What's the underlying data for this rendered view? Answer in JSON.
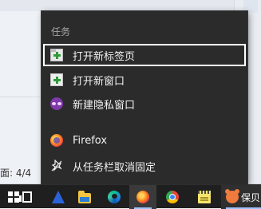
{
  "background": {
    "page_status": "面: 4/4",
    "accent_color": "#4a7bd0"
  },
  "jump_list": {
    "section_header": "任务",
    "tasks": [
      {
        "label": "打开新标签页",
        "icon": "new-tab-icon",
        "active": true
      },
      {
        "label": "打开新窗口",
        "icon": "new-window-icon",
        "active": false
      },
      {
        "label": "新建隐私窗口",
        "icon": "private-window-icon",
        "active": false
      }
    ],
    "app_label": "Firefox",
    "unpin_label": "从任务栏取消固定",
    "bg_color": "#2b2b2b",
    "text_color": "#f2f2f2"
  },
  "taskbar": {
    "bg_color": "#1f1f1f",
    "items": [
      {
        "name": "start-icon"
      },
      {
        "name": "task-view-icon"
      },
      {
        "name": "prism-app-icon"
      },
      {
        "name": "file-explorer-icon"
      },
      {
        "name": "edge-icon"
      },
      {
        "name": "firefox-icon",
        "active": true
      },
      {
        "name": "chrome-icon"
      },
      {
        "name": "notepad-icon"
      }
    ],
    "last_app_label": "保贝"
  }
}
